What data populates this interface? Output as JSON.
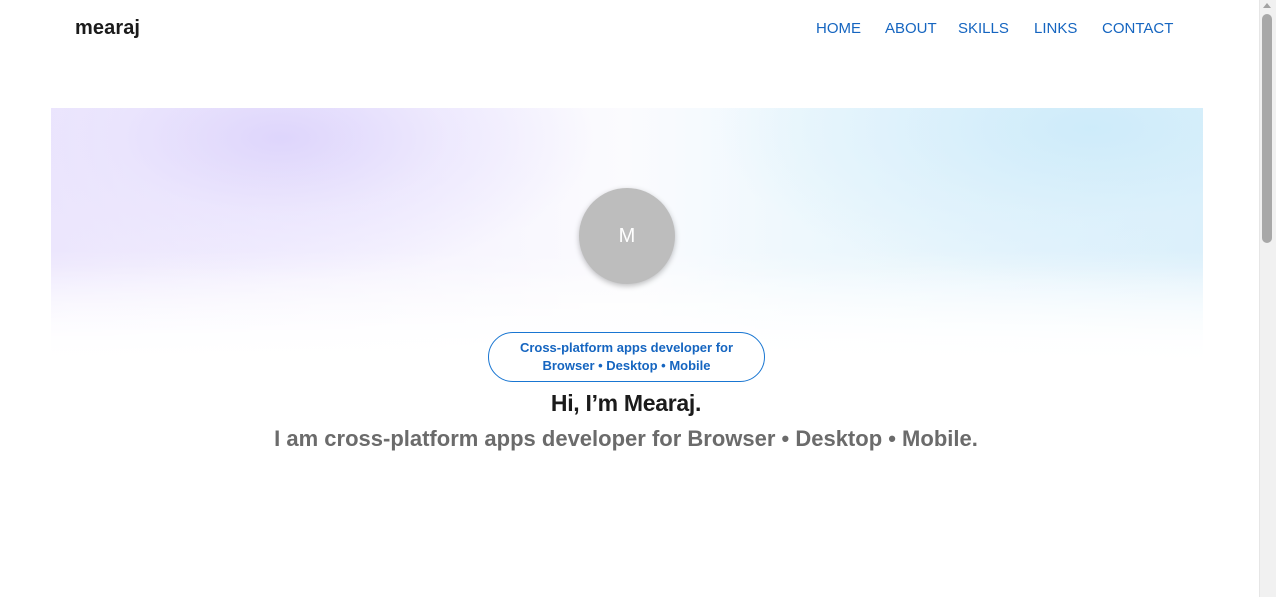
{
  "header": {
    "brand": "mearaj",
    "nav": {
      "home": "HOME",
      "about": "ABOUT",
      "skills": "SKILLS",
      "links": "LINKS",
      "contact": "CONTACT"
    }
  },
  "hero": {
    "avatar_initial": "M",
    "tag_line1": "Cross-platform apps developer for",
    "tag_line2": "Browser • Desktop • Mobile",
    "greeting": "Hi, I’m Mearaj.",
    "subtitle": "I am cross-platform apps developer for Browser • Desktop • Mobile."
  },
  "colors": {
    "nav_link": "#1565c0",
    "brand": "#1b1b1b",
    "avatar_bg": "#bdbdbd",
    "chip_border": "#1976d2",
    "subtitle": "#6b6b6b"
  },
  "scrollbar": {
    "position_fraction": 0.0
  }
}
